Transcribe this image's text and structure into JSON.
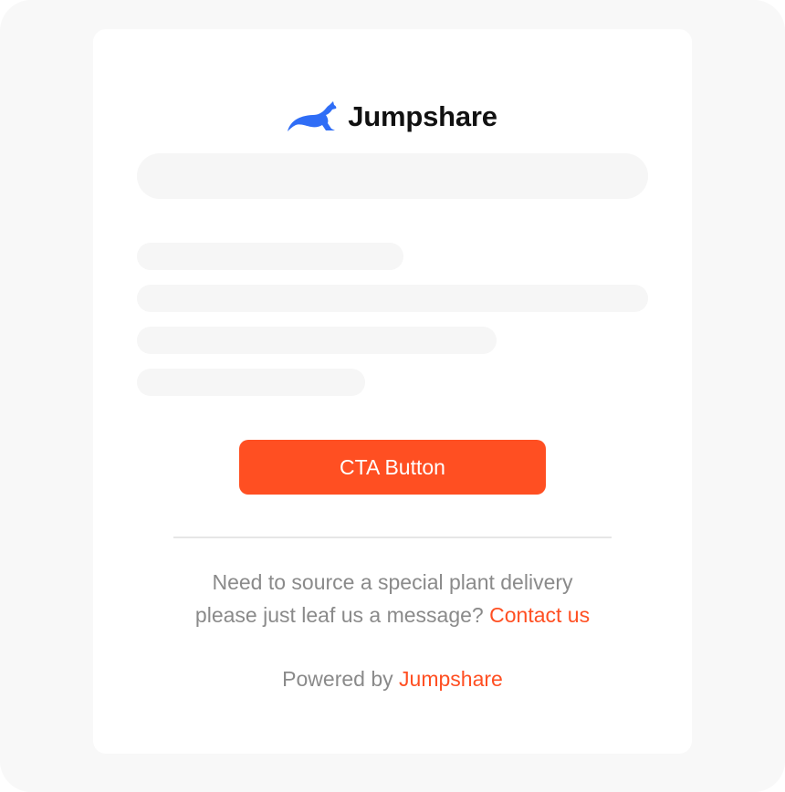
{
  "brand": {
    "name": "Jumpshare",
    "icon": "kangaroo-logo-icon",
    "icon_color": "#2f6df6"
  },
  "cta": {
    "label": "CTA Button",
    "color": "#ff4f22"
  },
  "message": {
    "line1": "Need to source a special plant delivery",
    "line2_text": "please just leaf us a message?",
    "link_label": "Contact us"
  },
  "footer": {
    "powered_prefix": "Powered by",
    "powered_link": "Jumpshare"
  },
  "colors": {
    "accent": "#ff4f22",
    "muted_text": "#8a8a8a",
    "placeholder": "#f6f6f6",
    "background": "#f8f8f8"
  }
}
